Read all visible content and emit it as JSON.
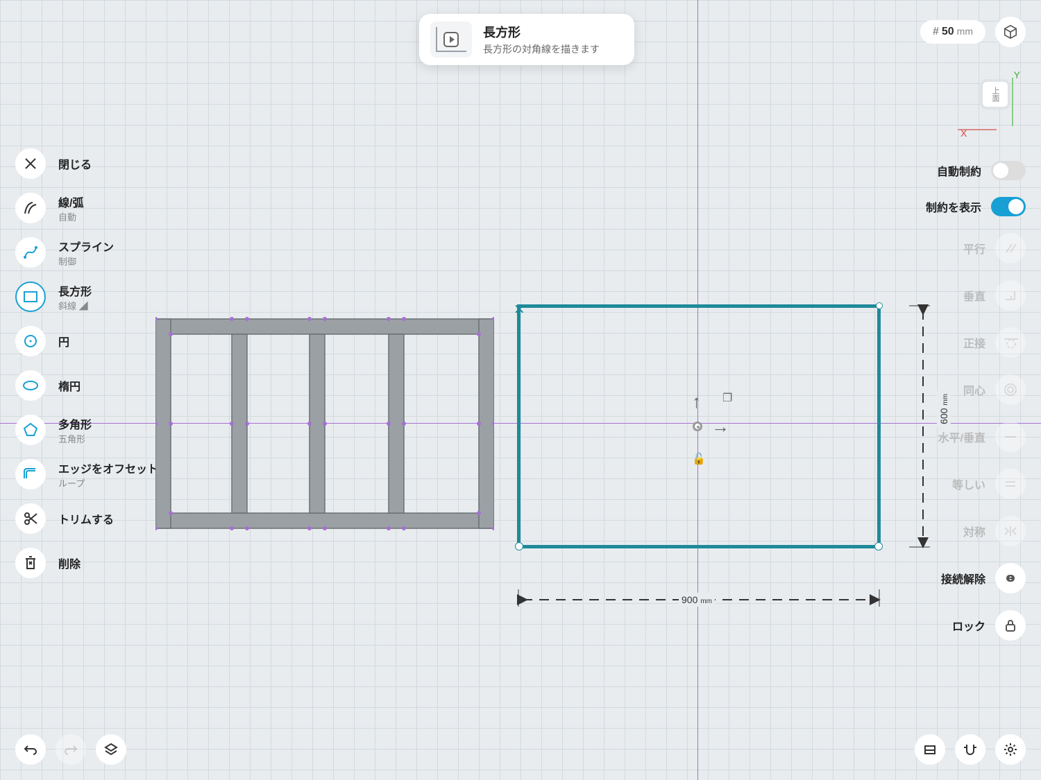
{
  "tooltip": {
    "title": "長方形",
    "subtitle": "長方形の対角線を描きます"
  },
  "gridSize": {
    "value": "50",
    "unit": "mm"
  },
  "axes": {
    "x": "X",
    "y": "Y",
    "face": "上面"
  },
  "leftTools": {
    "close": "閉じる",
    "lineArc": {
      "label": "線/弧",
      "sub": "自動"
    },
    "spline": {
      "label": "スプライン",
      "sub": "制御"
    },
    "rect": {
      "label": "長方形",
      "sub": "斜線"
    },
    "circle": "円",
    "ellipse": "楕円",
    "polygon": {
      "label": "多角形",
      "sub": "五角形"
    },
    "offset": {
      "label": "エッジをオフセット",
      "sub": "ループ"
    },
    "trim": "トリムする",
    "delete": "削除"
  },
  "rightTools": {
    "autoConstraint": "自動制約",
    "showConstraints": "制約を表示",
    "parallel": "平行",
    "perpendicular": "垂直",
    "tangent": "正接",
    "concentric": "同心",
    "horizVert": "水平/垂直",
    "equal": "等しい",
    "symmetric": "対称",
    "disconnect": "接続解除",
    "lock": "ロック"
  },
  "dimensions": {
    "width": "900",
    "height": "600",
    "unit": "mm"
  }
}
